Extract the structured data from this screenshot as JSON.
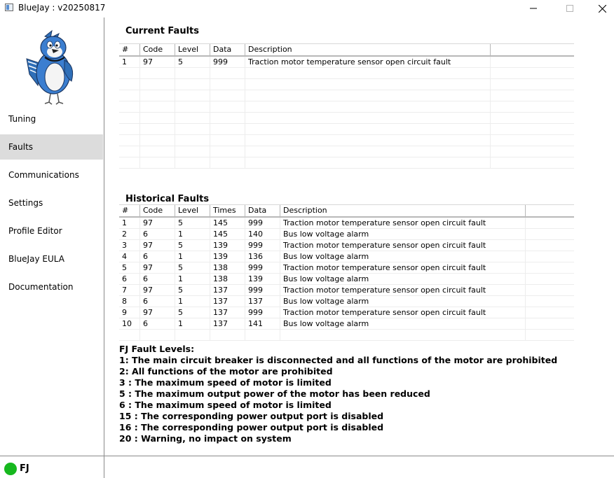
{
  "window": {
    "title": "BlueJay : v20250817",
    "minimize": "—",
    "maximize": "☐",
    "close": "✕"
  },
  "sidebar": {
    "items": [
      {
        "label": "Tuning"
      },
      {
        "label": "Faults"
      },
      {
        "label": "Communications"
      },
      {
        "label": "Settings"
      },
      {
        "label": "Profile Editor"
      },
      {
        "label": "BlueJay EULA"
      },
      {
        "label": "Documentation"
      }
    ]
  },
  "current_faults": {
    "title": "Current Faults",
    "columns": [
      "#",
      "Code",
      "Level",
      "Data",
      "Description"
    ],
    "rows": [
      [
        "1",
        "97",
        "5",
        "999",
        "Traction motor temperature sensor open circuit fault"
      ]
    ]
  },
  "historical_faults": {
    "title": "Historical Faults",
    "columns": [
      "#",
      "Code",
      "Level",
      "Times",
      "Data",
      "Description"
    ],
    "rows": [
      [
        "1",
        "97",
        "5",
        "145",
        "999",
        "Traction motor temperature sensor open circuit fault"
      ],
      [
        "2",
        "6",
        "1",
        "145",
        "140",
        "Bus low voltage alarm"
      ],
      [
        "3",
        "97",
        "5",
        "139",
        "999",
        "Traction motor temperature sensor open circuit fault"
      ],
      [
        "4",
        "6",
        "1",
        "139",
        "136",
        "Bus low voltage alarm"
      ],
      [
        "5",
        "97",
        "5",
        "138",
        "999",
        "Traction motor temperature sensor open circuit fault"
      ],
      [
        "6",
        "6",
        "1",
        "138",
        "139",
        "Bus low voltage alarm"
      ],
      [
        "7",
        "97",
        "5",
        "137",
        "999",
        "Traction motor temperature sensor open circuit fault"
      ],
      [
        "8",
        "6",
        "1",
        "137",
        "137",
        "Bus low voltage alarm"
      ],
      [
        "9",
        "97",
        "5",
        "137",
        "999",
        "Traction motor temperature sensor open circuit fault"
      ],
      [
        "10",
        "6",
        "1",
        "137",
        "141",
        "Bus low voltage alarm"
      ]
    ]
  },
  "fault_levels": {
    "title": "FJ Fault Levels:",
    "lines": [
      "1: The main circuit breaker is disconnected and all functions of the motor are prohibited",
      "2: All functions of the motor are prohibited",
      "3 : The maximum speed of motor is limited",
      "5 : The maximum output power of the motor has been reduced",
      "6 : The maximum speed of motor is limited",
      "15 : The corresponding power output port is disabled",
      "16 : The corresponding power output port is disabled",
      "20 : Warning, no impact on system"
    ]
  },
  "status": {
    "label": "FJ",
    "indicator_color": "#16b81e"
  }
}
